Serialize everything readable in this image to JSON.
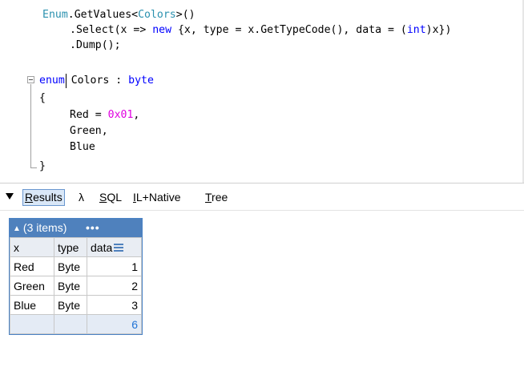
{
  "editor": {
    "lines": {
      "l1": {
        "a": "Enum",
        "b": ".GetValues<",
        "c": "Colors",
        "d": ">()"
      },
      "l2": {
        "a": ".Select(x => ",
        "b": "new",
        "c": " {x, type = x.GetTypeCode(), data = (",
        "d": "int",
        "e": ")x})"
      },
      "l3": {
        "a": ".Dump();"
      },
      "l4": {
        "a": "enum",
        "b": " Colors : ",
        "c": "byte"
      },
      "l5": {
        "a": "{"
      },
      "l6": {
        "a": "Red = ",
        "b": "0x01",
        "c": ","
      },
      "l7": {
        "a": "Green,"
      },
      "l8": {
        "a": "Blue"
      },
      "l9": {
        "a": "}"
      }
    }
  },
  "tabs": [
    {
      "label_ul": "R",
      "label_rest": "esults"
    },
    {
      "label": "λ"
    },
    {
      "label_ul": "S",
      "label_rest": "QL"
    },
    {
      "label_ul": "I",
      "label_rest": "L+Native"
    },
    {
      "label_ul": "T",
      "label_rest": "ree"
    }
  ],
  "results": {
    "header": {
      "arrow": "▲",
      "title": "(3 items)",
      "more": "•••"
    },
    "columns": [
      "x",
      "type",
      "data"
    ],
    "rows": [
      {
        "x": "Red",
        "type": "Byte",
        "data": "1"
      },
      {
        "x": "Green",
        "type": "Byte",
        "data": "2"
      },
      {
        "x": "Blue",
        "type": "Byte",
        "data": "3"
      }
    ],
    "total": "6"
  },
  "colors": {
    "keyword": "#0000ff",
    "type": "#2b91af",
    "number": "#e000e0",
    "header_bg": "#4f81bd",
    "active_tab_bg": "#d9e7f7"
  }
}
